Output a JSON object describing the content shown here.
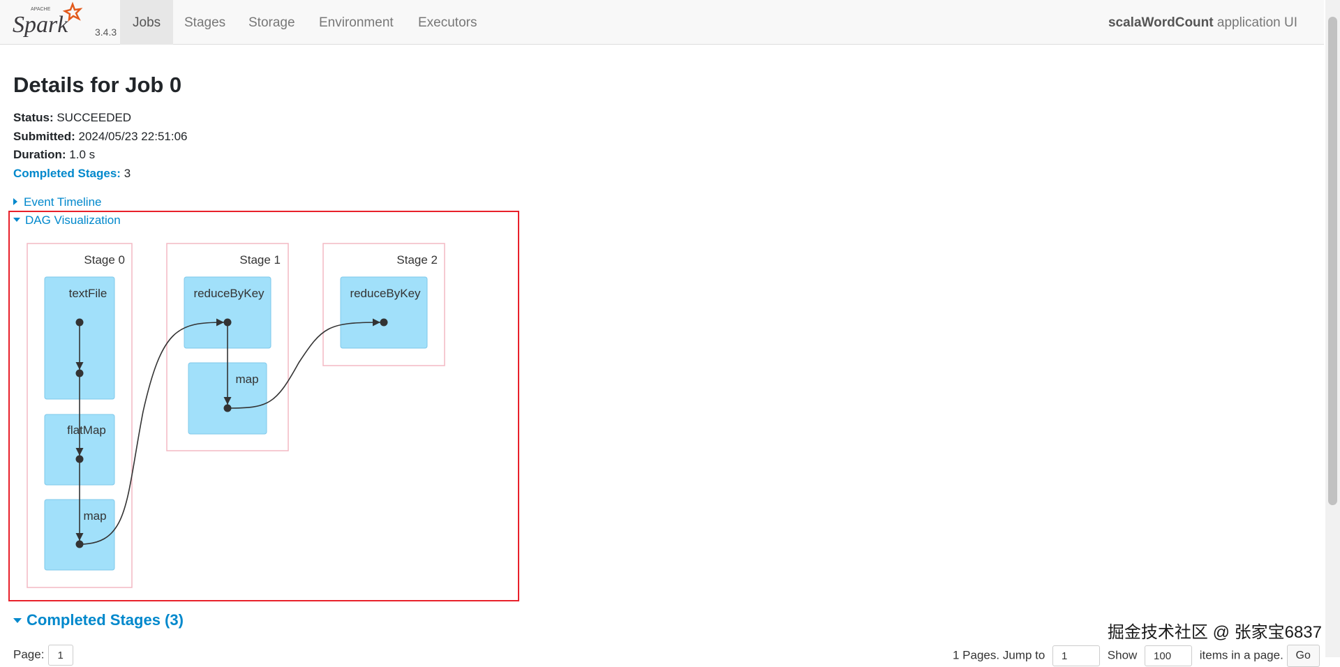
{
  "navbar": {
    "brand_wordmark": "Spark",
    "brand_small": "APACHE",
    "version": "3.4.3",
    "tabs": [
      {
        "label": "Jobs",
        "active": true
      },
      {
        "label": "Stages",
        "active": false
      },
      {
        "label": "Storage",
        "active": false
      },
      {
        "label": "Environment",
        "active": false
      },
      {
        "label": "Executors",
        "active": false
      }
    ],
    "app_name": "scalaWordCount",
    "app_suffix": " application UI"
  },
  "page": {
    "title": "Details for Job 0",
    "status_label": "Status:",
    "status_value": " SUCCEEDED",
    "submitted_label": "Submitted:",
    "submitted_value": " 2024/05/23 22:51:06",
    "duration_label": "Duration:",
    "duration_value": " 1.0 s",
    "completed_label": "Completed Stages:",
    "completed_value": " 3"
  },
  "toggles": {
    "event_timeline": "Event Timeline",
    "dag_visualization": "DAG Visualization"
  },
  "dag": {
    "stages": [
      {
        "label": "Stage 0",
        "nodes": [
          "textFile",
          "flatMap",
          "map"
        ]
      },
      {
        "label": "Stage 1",
        "nodes": [
          "reduceByKey",
          "map"
        ]
      },
      {
        "label": "Stage 2",
        "nodes": [
          "reduceByKey"
        ]
      }
    ]
  },
  "completed_stages": {
    "header": "Completed Stages (3)"
  },
  "pagination": {
    "page_label": "Page:",
    "page_value": "1",
    "pages_text": "1 Pages. Jump to",
    "jump_value": "1",
    "show_label": "Show",
    "show_value": "100",
    "items_text": "items in a page.",
    "go_label": "Go"
  },
  "overlay": {
    "credit": "掘金技术社区 @ 张家宝6837"
  },
  "colors": {
    "link": "#0088cc",
    "highlight": "#e8202a",
    "node_fill": "#a1e0fa",
    "stage_border": "#f3b8c3"
  }
}
